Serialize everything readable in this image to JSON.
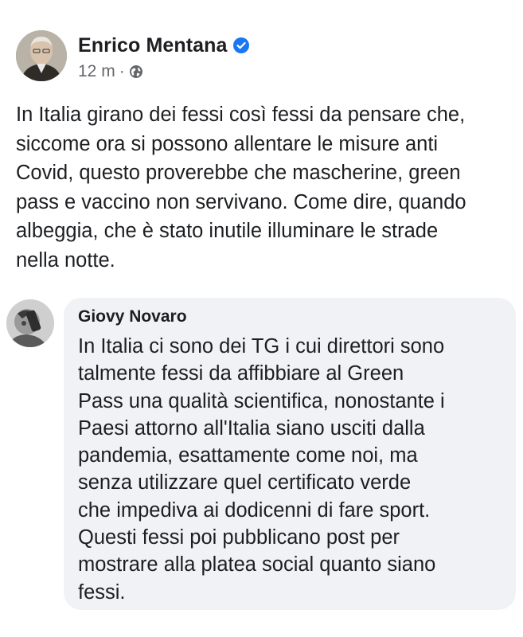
{
  "post": {
    "author": "Enrico Mentana",
    "time": "12 m",
    "separator": "·",
    "verified_icon": "verified-badge-icon",
    "privacy_icon": "globe-icon",
    "text_lines": [
      "In Italia girano dei fessi così fessi da pensare che,",
      "siccome ora si possono allentare le misure anti",
      "Covid, questo proverebbe che mascherine, green",
      "pass e vaccino non servivano. Come dire, quando",
      "albeggia, che è stato inutile illuminare le strade",
      "nella notte."
    ]
  },
  "comment": {
    "author": "Giovy Novaro",
    "text_lines": [
      "In Italia ci sono dei TG i cui direttori sono",
      "talmente fessi da affibbiare al Green",
      "Pass una qualità scientifica, nonostante i",
      "Paesi attorno all'Italia siano usciti dalla",
      "pandemia, esattamente come noi, ma",
      "senza utilizzare quel certificato verde",
      "che impediva ai dodicenni di fare sport.",
      "Questi fessi poi pubblicano post per",
      "mostrare alla platea social quanto siano",
      "fessi."
    ]
  },
  "colors": {
    "text": "#1c1e21",
    "secondary_text": "#65676b",
    "verified_blue": "#1877f2",
    "bubble_bg": "#f0f2f5",
    "background": "#ffffff"
  }
}
